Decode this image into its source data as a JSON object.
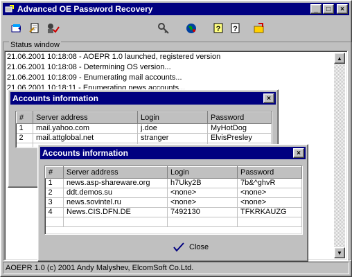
{
  "window": {
    "title": "Advanced OE Password Recovery",
    "minimize": "_",
    "maximize": "□",
    "close": "×"
  },
  "toolbar": {
    "icons": [
      "open-icon",
      "save-icon",
      "user-check-icon",
      "key-icon",
      "globe-icon",
      "help-icon",
      "help-context-icon",
      "exit-icon"
    ]
  },
  "status": {
    "legend": "Status window",
    "lines": [
      "21.06.2001 10:18:08 - AOEPR 1.0 launched, registered version",
      "21.06.2001 10:18:08 - Determining OS version...",
      "21.06.2001 10:18:09 - Enumerating mail accounts...",
      "21.06.2001 10:18:11 - Enumerating news accounts..."
    ]
  },
  "statusbar": {
    "text": "AOEPR 1.0 (c) 2001 Andy Malyshev, ElcomSoft Co.Ltd."
  },
  "dialog_mail": {
    "title": "Accounts information",
    "close": "×",
    "columns": [
      "#",
      "Server address",
      "Login",
      "Password"
    ],
    "rows": [
      [
        "1",
        "mail.yahoo.com",
        "j.doe",
        "MyHotDog"
      ],
      [
        "2",
        "mail.attglobal.net",
        "stranger",
        "ElvisPresley"
      ]
    ]
  },
  "dialog_news": {
    "title": "Accounts information",
    "close": "×",
    "columns": [
      "#",
      "Server address",
      "Login",
      "Password"
    ],
    "rows": [
      [
        "1",
        "news.asp-shareware.org",
        "h7Uky2B",
        "7b&^ghvR"
      ],
      [
        "2",
        "ddt.demos.su",
        "<none>",
        "<none>"
      ],
      [
        "3",
        "news.sovintel.ru",
        "<none>",
        "<none>"
      ],
      [
        "4",
        "News.CIS.DFN.DE",
        "7492130",
        "TFKRKAUZG"
      ]
    ],
    "close_button": "Close"
  }
}
